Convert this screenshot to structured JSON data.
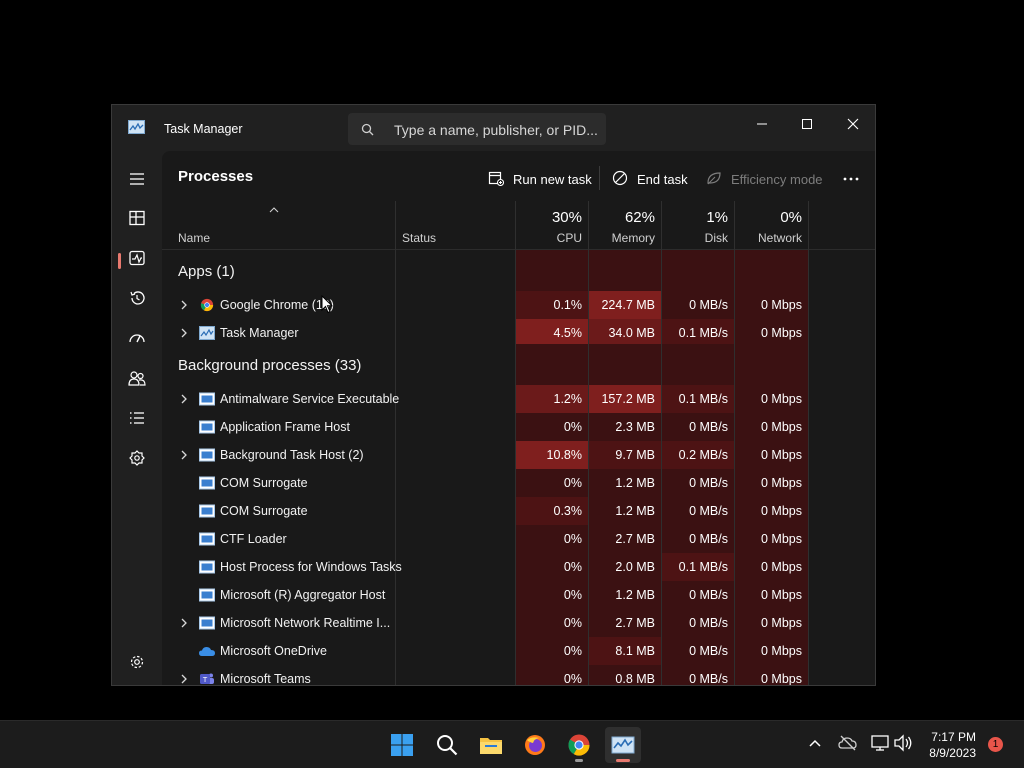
{
  "window": {
    "title": "Task Manager"
  },
  "search": {
    "placeholder": "Type a name, publisher, or PID..."
  },
  "nav": {
    "items": [
      "hamburger-menu",
      "processes",
      "performance",
      "app-history",
      "startup-apps",
      "users",
      "details",
      "services",
      "settings"
    ]
  },
  "page": {
    "title": "Processes",
    "commands": {
      "run_new_task": "Run new task",
      "end_task": "End task",
      "efficiency_mode": "Efficiency mode"
    }
  },
  "columns": {
    "name": "Name",
    "status": "Status",
    "cpu": {
      "pct": "30%",
      "label": "CPU"
    },
    "memory": {
      "pct": "62%",
      "label": "Memory"
    },
    "disk": {
      "pct": "1%",
      "label": "Disk"
    },
    "network": {
      "pct": "0%",
      "label": "Network"
    }
  },
  "groups": {
    "apps": "Apps (1)",
    "background": "Background processes (33)"
  },
  "rows": [
    {
      "name": "Google Chrome (10)",
      "cpu": "0.1%",
      "memory": "224.7 MB",
      "disk": "0 MB/s",
      "network": "0 Mbps",
      "expandable": true,
      "icon": "chrome-icon"
    },
    {
      "name": "Task Manager",
      "cpu": "4.5%",
      "memory": "34.0 MB",
      "disk": "0.1 MB/s",
      "network": "0 Mbps",
      "expandable": true,
      "icon": "task-manager-icon"
    },
    {
      "name": "Antimalware Service Executable",
      "cpu": "1.2%",
      "memory": "157.2 MB",
      "disk": "0.1 MB/s",
      "network": "0 Mbps",
      "expandable": true,
      "icon": "process-icon"
    },
    {
      "name": "Application Frame Host",
      "cpu": "0%",
      "memory": "2.3 MB",
      "disk": "0 MB/s",
      "network": "0 Mbps",
      "expandable": false,
      "icon": "process-icon"
    },
    {
      "name": "Background Task Host (2)",
      "cpu": "10.8%",
      "memory": "9.7 MB",
      "disk": "0.2 MB/s",
      "network": "0 Mbps",
      "expandable": true,
      "icon": "process-icon"
    },
    {
      "name": "COM Surrogate",
      "cpu": "0%",
      "memory": "1.2 MB",
      "disk": "0 MB/s",
      "network": "0 Mbps",
      "expandable": false,
      "icon": "process-icon"
    },
    {
      "name": "COM Surrogate",
      "cpu": "0.3%",
      "memory": "1.2 MB",
      "disk": "0 MB/s",
      "network": "0 Mbps",
      "expandable": false,
      "icon": "process-icon"
    },
    {
      "name": "CTF Loader",
      "cpu": "0%",
      "memory": "2.7 MB",
      "disk": "0 MB/s",
      "network": "0 Mbps",
      "expandable": false,
      "icon": "process-icon"
    },
    {
      "name": "Host Process for Windows Tasks",
      "cpu": "0%",
      "memory": "2.0 MB",
      "disk": "0.1 MB/s",
      "network": "0 Mbps",
      "expandable": false,
      "icon": "process-icon"
    },
    {
      "name": "Microsoft (R) Aggregator Host",
      "cpu": "0%",
      "memory": "1.2 MB",
      "disk": "0 MB/s",
      "network": "0 Mbps",
      "expandable": false,
      "icon": "process-icon"
    },
    {
      "name": "Microsoft Network Realtime I...",
      "cpu": "0%",
      "memory": "2.7 MB",
      "disk": "0 MB/s",
      "network": "0 Mbps",
      "expandable": true,
      "icon": "process-icon"
    },
    {
      "name": "Microsoft OneDrive",
      "cpu": "0%",
      "memory": "8.1 MB",
      "disk": "0 MB/s",
      "network": "0 Mbps",
      "expandable": false,
      "icon": "onedrive-icon"
    },
    {
      "name": "Microsoft Teams",
      "cpu": "0%",
      "memory": "0.8 MB",
      "disk": "0 MB/s",
      "network": "0 Mbps",
      "expandable": true,
      "icon": "teams-icon"
    }
  ],
  "taskbar": {
    "apps": [
      "start-icon",
      "search-icon",
      "file-explorer-icon",
      "firefox-icon",
      "chrome-icon",
      "task-manager-icon"
    ],
    "clock": {
      "time": "7:17 PM",
      "date": "8/9/2023"
    },
    "notifications": "1"
  },
  "colors": {
    "accent": "#e8796f",
    "heat_low": "#3b1112",
    "heat_high": "#7f1f1e"
  }
}
